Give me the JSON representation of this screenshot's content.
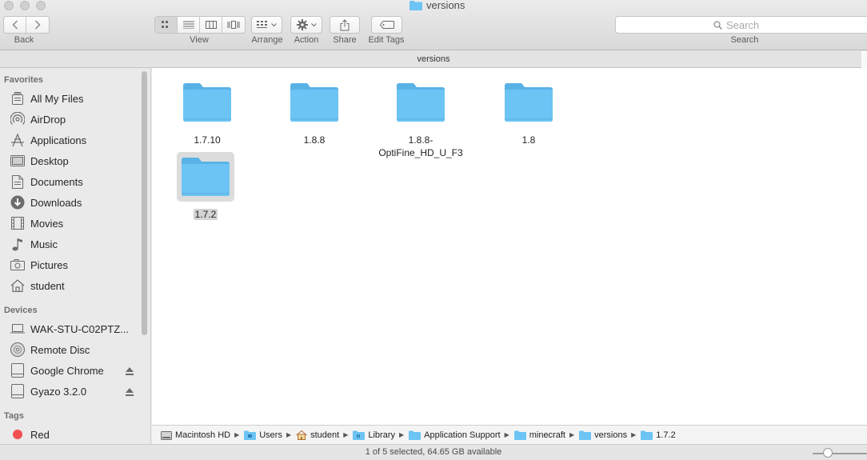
{
  "window": {
    "title": "versions"
  },
  "toolbar": {
    "back_label": "Back",
    "view_label": "View",
    "arrange_label": "Arrange",
    "action_label": "Action",
    "share_label": "Share",
    "edit_tags_label": "Edit Tags",
    "search_placeholder": "Search",
    "search_label": "Search",
    "view_modes": [
      "icon-view-icon",
      "list-view-icon",
      "column-view-icon",
      "cover-flow-icon"
    ],
    "active_view": "icon"
  },
  "path_title": "versions",
  "sidebar": {
    "favorites_heading": "Favorites",
    "favorites": [
      {
        "label": "All My Files",
        "icon": "all-files-icon"
      },
      {
        "label": "AirDrop",
        "icon": "airdrop-icon"
      },
      {
        "label": "Applications",
        "icon": "applications-icon"
      },
      {
        "label": "Desktop",
        "icon": "desktop-icon"
      },
      {
        "label": "Documents",
        "icon": "documents-icon"
      },
      {
        "label": "Downloads",
        "icon": "downloads-icon"
      },
      {
        "label": "Movies",
        "icon": "movies-icon"
      },
      {
        "label": "Music",
        "icon": "music-icon"
      },
      {
        "label": "Pictures",
        "icon": "pictures-icon"
      },
      {
        "label": "student",
        "icon": "home-icon"
      }
    ],
    "devices_heading": "Devices",
    "devices": [
      {
        "label": "WAK-STU-C02PTZ...",
        "icon": "laptop-icon"
      },
      {
        "label": "Remote Disc",
        "icon": "disc-icon"
      },
      {
        "label": "Google Chrome",
        "icon": "drive-icon",
        "eject": true
      },
      {
        "label": "Gyazo 3.2.0",
        "icon": "drive-icon",
        "eject": true
      }
    ],
    "tags_heading": "Tags",
    "tags": [
      {
        "label": "Red",
        "color": "#f25050"
      }
    ]
  },
  "files": [
    {
      "name": "1.7.10",
      "selected": false
    },
    {
      "name": "1.8.8",
      "selected": false
    },
    {
      "name": "1.8.8-\nOptiFine_HD_U_F3",
      "name_line1": "1.8.8-",
      "name_line2": "OptiFine_HD_U_F3",
      "selected": false
    },
    {
      "name": "1.8",
      "selected": false
    },
    {
      "name": "1.7.2",
      "selected": true
    }
  ],
  "pathbar": [
    {
      "label": "Macintosh HD",
      "icon": "hard-drive-icon"
    },
    {
      "label": "Users",
      "icon": "folder-icon"
    },
    {
      "label": "student",
      "icon": "home-icon"
    },
    {
      "label": "Library",
      "icon": "folder-icon"
    },
    {
      "label": "Application Support",
      "icon": "folder-icon"
    },
    {
      "label": "minecraft",
      "icon": "folder-icon"
    },
    {
      "label": "versions",
      "icon": "folder-icon"
    },
    {
      "label": "1.7.2",
      "icon": "folder-icon"
    }
  ],
  "status": {
    "text": "1 of 5 selected, 64.65 GB available"
  },
  "colors": {
    "folder": "#6cc4f4",
    "folder_dark": "#58b2e6",
    "selection": "#d4d4d4",
    "tag_red": "#f25050"
  }
}
